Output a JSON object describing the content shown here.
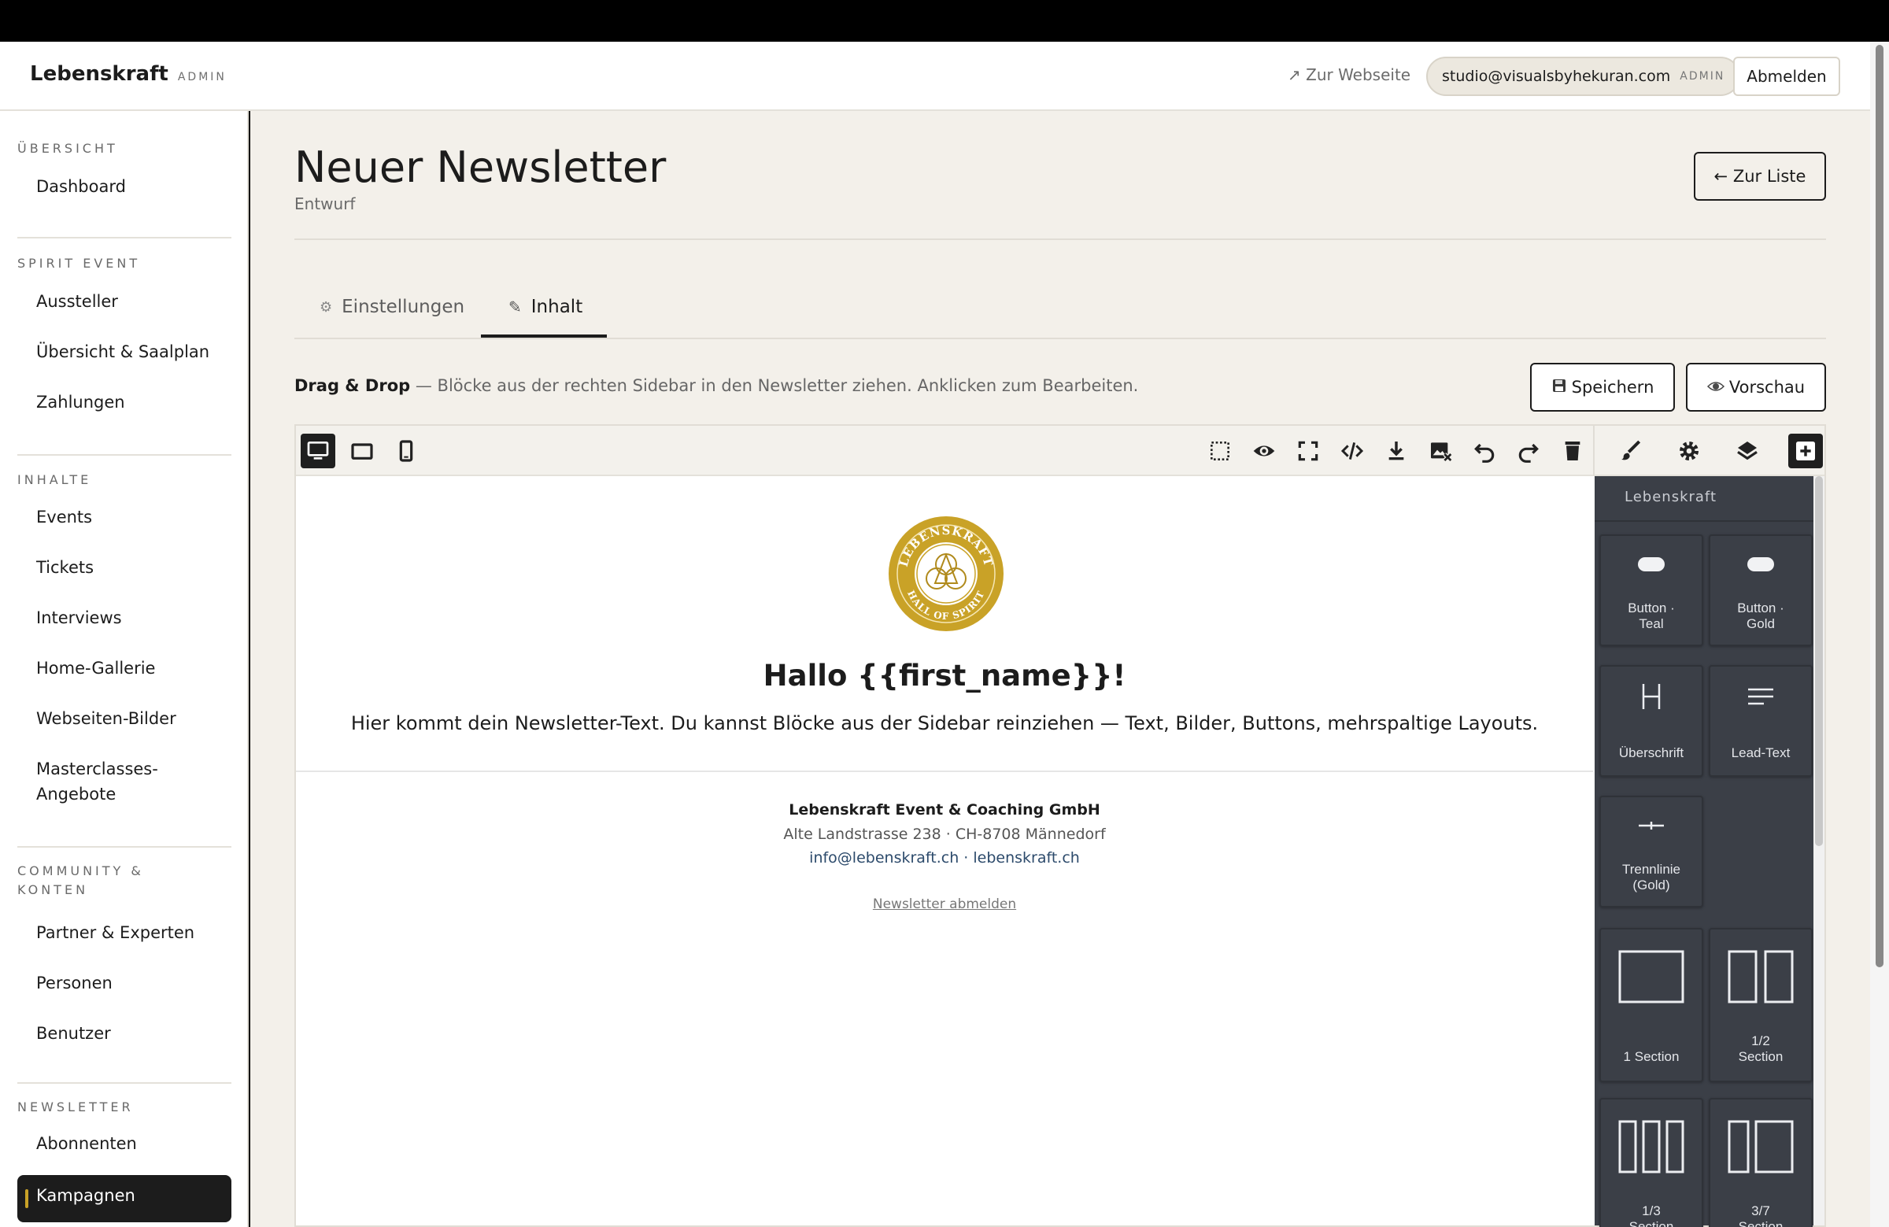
{
  "header": {
    "brand": "Lebenskraft",
    "brand_tag": "ADMIN",
    "site_link": "↗ Zur Webseite",
    "user_email": "studio@visualsbyhekuran.com",
    "user_role": "ADMIN",
    "logout": "Abmelden"
  },
  "sidebar": {
    "groups": [
      {
        "heading": "ÜBERSICHT",
        "items": [
          "Dashboard"
        ]
      },
      {
        "heading": "SPIRIT EVENT",
        "items": [
          "Aussteller",
          "Übersicht & Saalplan",
          "Zahlungen"
        ]
      },
      {
        "heading": "INHALTE",
        "items": [
          "Events",
          "Tickets",
          "Interviews",
          "Home-Gallerie",
          "Webseiten-Bilder",
          "Masterclasses-",
          "Angebote"
        ]
      },
      {
        "heading": "COMMUNITY &",
        "heading2": "KONTEN",
        "items": [
          "Partner & Experten",
          "Personen",
          "Benutzer"
        ]
      },
      {
        "heading": "NEWSLETTER",
        "items": [
          "Abonnenten",
          "Kampagnen"
        ]
      }
    ]
  },
  "page": {
    "title": "Neuer Newsletter",
    "status": "Entwurf",
    "back_button": "← Zur Liste",
    "tabs": [
      {
        "label": "Einstellungen",
        "icon": "gear-icon",
        "active": false
      },
      {
        "label": "Inhalt",
        "icon": "pencil-icon",
        "active": true
      }
    ],
    "hint_bold": "Drag & Drop",
    "hint_text": " — Blöcke aus der rechten Sidebar in den Newsletter ziehen. Anklicken zum Bearbeiten.",
    "save_button": "Speichern",
    "preview_button": "Vorschau"
  },
  "editor": {
    "greeting": "Hallo {{first_name}}!",
    "body": "Hier kommt dein Newsletter-Text. Du kannst Blöcke aus der Sidebar reinziehen — Text, Bilder, Buttons, mehrspaltige Layouts.",
    "footer_company": "Lebenskraft Event & Coaching GmbH",
    "footer_address": "Alte Landstrasse 238 · CH-8708 Männedorf",
    "footer_links": "info@lebenskraft.ch · lebenskraft.ch",
    "unsubscribe": "Newsletter abmelden",
    "logo_text_top": "LEBENSKRAFT",
    "logo_text_bottom": "HALL OF SPIRIT"
  },
  "blocks_panel": {
    "category": "Lebenskraft",
    "blocks": [
      {
        "label1": "Button ·",
        "label2": "Teal"
      },
      {
        "label1": "Button ·",
        "label2": "Gold"
      },
      {
        "label1": "Überschrift",
        "label2": ""
      },
      {
        "label1": "Lead-Text",
        "label2": ""
      },
      {
        "label1": "Trennlinie",
        "label2": "(Gold)"
      },
      {
        "label1": "1 Section",
        "label2": ""
      },
      {
        "label1": "1/2",
        "label2": "Section"
      },
      {
        "label1": "1/3",
        "label2": "Section"
      },
      {
        "label1": "3/7",
        "label2": "Section"
      }
    ]
  },
  "colors": {
    "accent_gold": "#c9a227",
    "dark": "#1c1c1c",
    "panel": "#3b3f47",
    "background": "#f3f0ea"
  }
}
